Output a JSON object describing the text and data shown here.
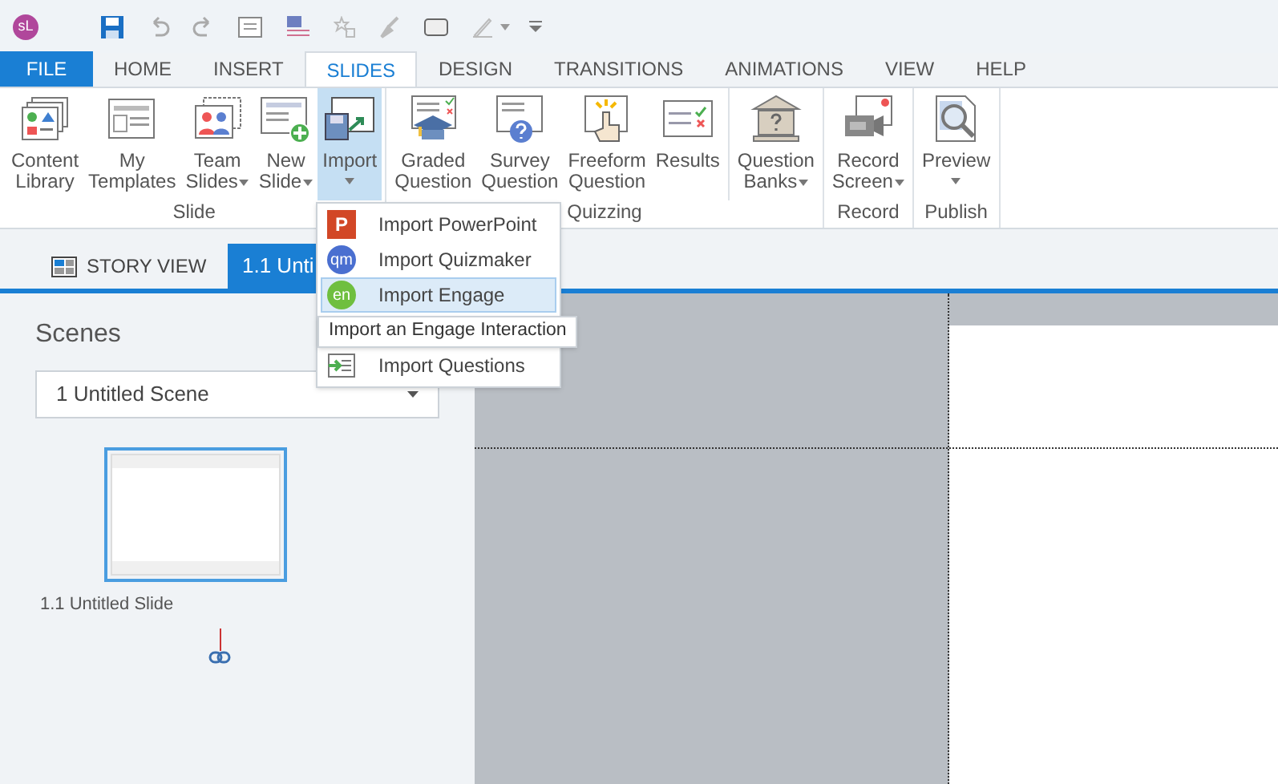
{
  "app_logo": "sL",
  "ribbon_tabs": [
    {
      "label": "FILE",
      "kind": "file",
      "selected": false
    },
    {
      "label": "HOME",
      "kind": "tab",
      "selected": false
    },
    {
      "label": "INSERT",
      "kind": "tab",
      "selected": false
    },
    {
      "label": "SLIDES",
      "kind": "tab",
      "selected": true
    },
    {
      "label": "DESIGN",
      "kind": "tab",
      "selected": false
    },
    {
      "label": "TRANSITIONS",
      "kind": "tab",
      "selected": false
    },
    {
      "label": "ANIMATIONS",
      "kind": "tab",
      "selected": false
    },
    {
      "label": "VIEW",
      "kind": "tab",
      "selected": false
    },
    {
      "label": "HELP",
      "kind": "tab",
      "selected": false
    }
  ],
  "ribbon_groups": [
    {
      "label": "Slide",
      "buttons": [
        {
          "kind": "library",
          "lines": [
            "Content",
            "Library"
          ],
          "has_menu": false,
          "selected": false
        },
        {
          "kind": "templates",
          "lines": [
            "My",
            "Templates"
          ],
          "has_menu": false,
          "selected": false
        },
        {
          "kind": "team",
          "lines": [
            "Team",
            "Slides"
          ],
          "has_menu": true,
          "selected": false
        },
        {
          "kind": "new",
          "lines": [
            "New",
            "Slide"
          ],
          "has_menu": true,
          "selected": false
        },
        {
          "kind": "import",
          "lines": [
            "Import"
          ],
          "has_menu": true,
          "selected": true
        }
      ]
    },
    {
      "label": "Quizzing",
      "buttons": [
        {
          "kind": "graded",
          "lines": [
            "Graded",
            "Question"
          ],
          "has_menu": false,
          "selected": false
        },
        {
          "kind": "survey",
          "lines": [
            "Survey",
            "Question"
          ],
          "has_menu": false,
          "selected": false
        },
        {
          "kind": "freeform",
          "lines": [
            "Freeform",
            "Question"
          ],
          "has_menu": false,
          "selected": false
        },
        {
          "kind": "results",
          "lines": [
            "Results"
          ],
          "has_menu": false,
          "selected": false
        },
        {
          "kind": "banks",
          "lines": [
            "Question",
            "Banks"
          ],
          "has_menu": true,
          "selected": false
        }
      ]
    },
    {
      "label": "Record",
      "buttons": [
        {
          "kind": "record",
          "lines": [
            "Record",
            "Screen"
          ],
          "has_menu": true,
          "selected": false
        }
      ]
    },
    {
      "label": "Publish",
      "buttons": [
        {
          "kind": "preview",
          "lines": [
            "Preview"
          ],
          "has_menu": true,
          "selected": false
        }
      ]
    }
  ],
  "import_menu": {
    "items": [
      {
        "kind": "powerpoint",
        "icon_text": "P",
        "label": "Import PowerPoint",
        "selected": false
      },
      {
        "kind": "quizmaker",
        "icon_text": "qm",
        "label": "Import Quizmaker",
        "selected": false
      },
      {
        "kind": "engage",
        "icon_text": "en",
        "label": "Import Engage",
        "selected": true
      },
      {
        "kind": "questions",
        "label": "Import Questions",
        "selected": false
      }
    ],
    "tooltip": "Import an Engage Interaction"
  },
  "view_tabs": [
    {
      "kind": "story",
      "label": "STORY VIEW",
      "selected": false
    },
    {
      "kind": "slide",
      "label": "1.1 Unti",
      "selected": true
    }
  ],
  "scenes": {
    "title": "Scenes",
    "scene_select": "1 Untitled Scene",
    "slides": [
      {
        "label": "1.1 Untitled Slide",
        "selected": true
      }
    ]
  }
}
